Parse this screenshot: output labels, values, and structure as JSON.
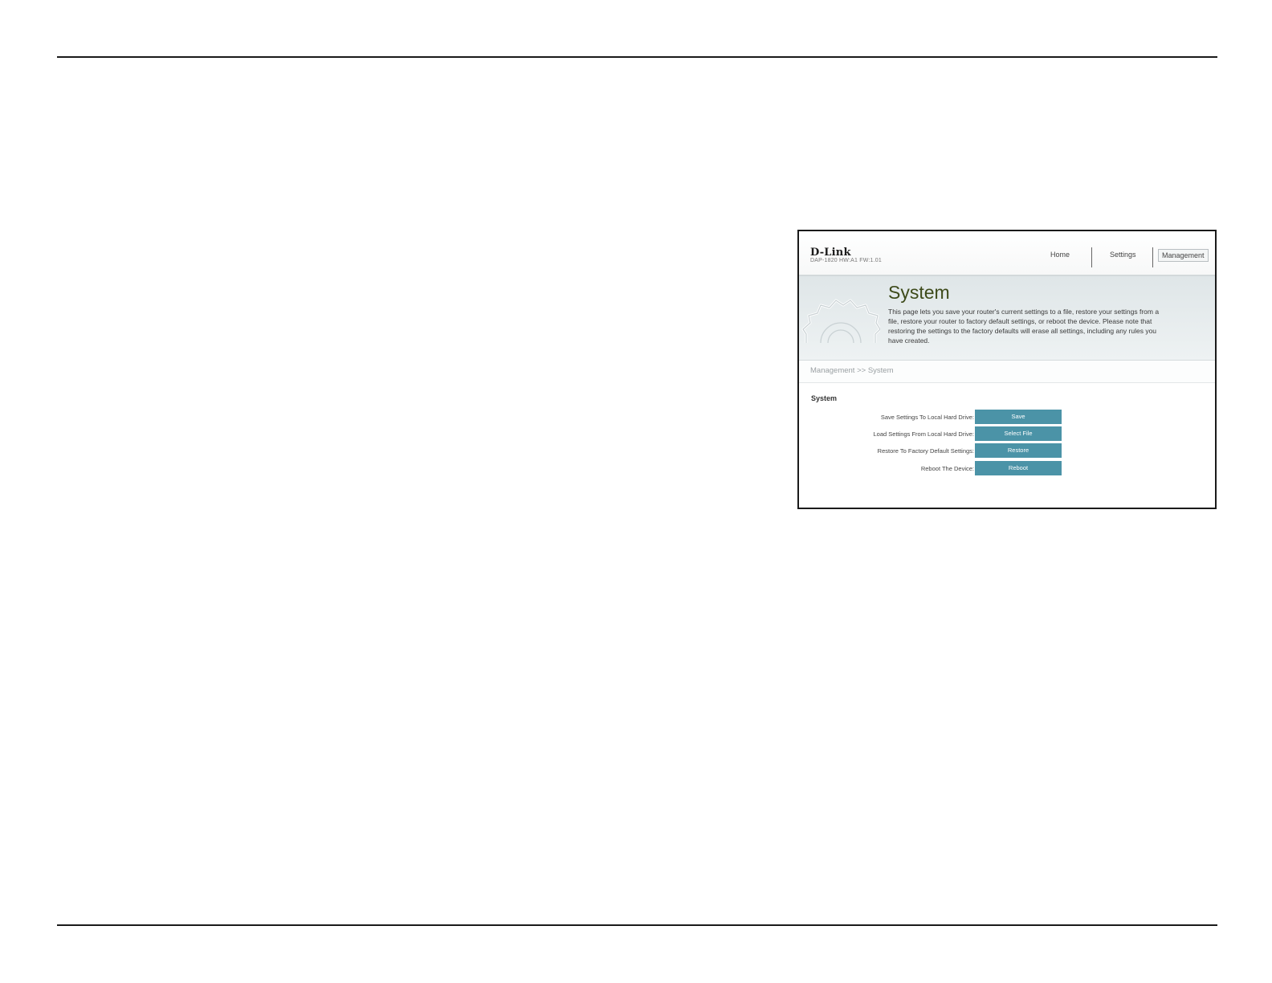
{
  "router_ui": {
    "brand": "D-Link",
    "model_info": "DAP-1820  HW:A1  FW:1.01",
    "nav": {
      "home": "Home",
      "settings": "Settings",
      "management": "Management"
    },
    "hero": {
      "title": "System",
      "description": "This page lets you save your router's current settings to a file, restore your settings from a file, restore your router to factory default settings, or reboot the device. Please note that restoring the settings to the factory defaults will erase all settings, including any rules you have created."
    },
    "breadcrumb": "Management >> System",
    "section_title": "System",
    "rows": [
      {
        "label": "Save Settings To Local Hard Drive:",
        "button": "Save"
      },
      {
        "label": "Load Settings From Local Hard Drive:",
        "button": "Select File"
      },
      {
        "label": "Restore To Factory Default Settings:",
        "button": "Restore"
      },
      {
        "label": "Reboot The Device:",
        "button": "Reboot"
      }
    ]
  },
  "colors": {
    "accent_button": "#4b93a7",
    "hero_title": "#3d4a1a"
  }
}
